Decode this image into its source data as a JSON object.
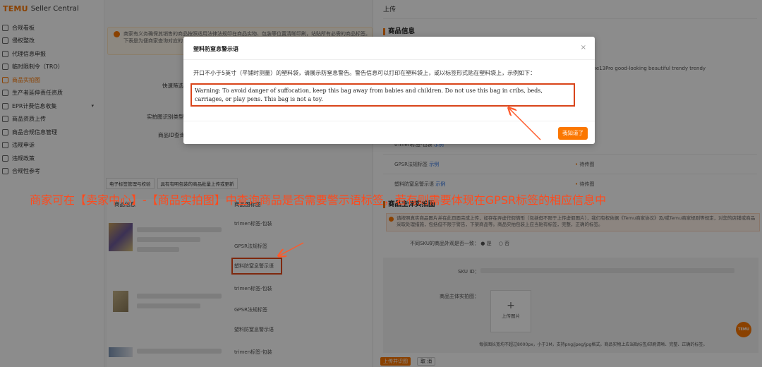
{
  "app": {
    "brand": "TEMU",
    "product": "Seller Central"
  },
  "sidebar": {
    "items": [
      {
        "label": "合规看板",
        "icon": "dashboard-icon"
      },
      {
        "label": "侵权整改",
        "icon": "rectify-icon"
      },
      {
        "label": "代理信息申报",
        "icon": "declare-icon"
      },
      {
        "label": "临时限制令（TRO）",
        "icon": "restraint-icon"
      },
      {
        "label": "商品实拍图",
        "icon": "photo-icon",
        "active": true
      },
      {
        "label": "生产者延伸责任资质",
        "icon": "qualification-icon"
      },
      {
        "label": "EPR计费信息收集",
        "icon": "epr-icon",
        "has_children": true
      },
      {
        "label": "商品资质上传",
        "icon": "upload-icon"
      },
      {
        "label": "商品合规信息管理",
        "icon": "compliance-icon"
      },
      {
        "label": "违规申诉",
        "icon": "appeal-icon"
      },
      {
        "label": "违规政策",
        "icon": "policy-icon"
      },
      {
        "label": "合规性参考",
        "icon": "reference-icon"
      }
    ]
  },
  "middle": {
    "notice": "商家有义务确保其销售的商品按照适用法律法规印在商品实物、包装等位置清晰印刷，站贴所有必需的商品标签。下表是为便商家查询对应的站内标签/安全警示，仅供参考，不构成任何法律意见。",
    "form": {
      "row1": "快速筛选",
      "row2": "实拍图识别类型",
      "row3": "商品ID查询"
    },
    "tabs": [
      "电子标签管理与校验",
      "具有有明包装的商品批量上传或更新"
    ],
    "table": {
      "col1": "商品信息",
      "col2": "商品图标图",
      "cells": [
        "trimen标签-包装",
        "GPSR法规标签",
        "塑料防窒息警示语",
        "trimen标签-包装",
        "GPSR法规标签",
        "塑料防窒息警示语",
        "trimen标签-包装"
      ]
    }
  },
  "drawer": {
    "title": "上传",
    "section1": "商品信息",
    "product_name_snippet": "e iPhone13Pro good-looking beautiful trendy trendy",
    "rows": [
      {
        "label": "trimen标签-包装",
        "link": "示例",
        "status": ""
      },
      {
        "label": "GPSR法规标签",
        "link": "示例",
        "status": "待传图"
      },
      {
        "label": "塑料防窒息警示语",
        "link": "示例",
        "status": "待传图"
      }
    ],
    "section2": "商品主体实拍图",
    "note": "请按照真实商品图片并在此页面完成上传，如存在弄虚作假情形（包括但不限于上传虚假图片），我们有权依据《Temu商家协议》及/或Temu商家规则等规定，对您的店铺或商品采取处理措施，包括但不限于警告，下架商品等。商品实拍包装上应当贴有标签，完整，正确的标签。",
    "same_appearance": "不同SKU的商品外观是否一致：",
    "radio_yes": "是",
    "radio_no": "否",
    "sku_label": "SKU ID：",
    "photo_label": "商品主体实拍图：",
    "upload_label": "上传图片",
    "footnote": "每张图长宽均不超过8000px，小于3M，支持png/jpeg/jpg格式。商品实物上应当贴标签/印刷清晰、完整、正确的标签。",
    "submit": "上传并识图",
    "cancel": "取 消",
    "badge": "TEMU"
  },
  "modal": {
    "title": "塑料防窒息警示语",
    "close": "×",
    "description": "开口不小于5英寸（平铺时测量）的塑料袋，请展示防窒息警告。警告信息可以打印在塑料袋上，或以标签形式贴在塑料袋上，示例如下：",
    "warning": "Warning: To avoid danger of suffocation, keep this bag away from babies and children. Do not use this bag in cribs, beds, carriages, or play pens. This bag is not a toy.",
    "ok": "我知道了"
  },
  "annotation": "商家可在【卖家中心】-【商品实拍图】中查询商品是否需要警示语标签，若有则需要体现在GPSR标签的相应信息中",
  "colors": {
    "brand": "#fb7701",
    "highlight": "#e64a19",
    "annotation": "#ff4a1c"
  }
}
